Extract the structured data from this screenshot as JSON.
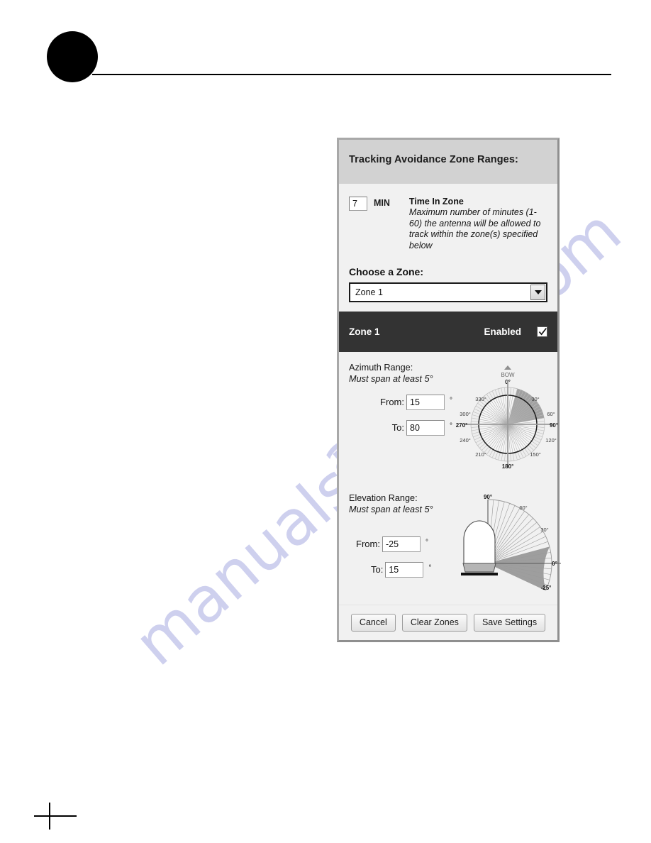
{
  "page": {
    "bullet_icon": "black-circle-bullet",
    "rule": "horizontal-rule",
    "crop_mark": "crop-mark",
    "watermark_text_1": "manualshive",
    "watermark_text_2": "alshive.com"
  },
  "dialog": {
    "title": "Tracking Avoidance Zone Ranges:",
    "time_in_zone": {
      "value": "7",
      "unit_label": "MIN",
      "heading": "Time In Zone",
      "description": "Maximum number of minutes (1-60) the antenna will be allowed to track within the zone(s) specified below"
    },
    "choose_zone": {
      "label": "Choose a Zone:",
      "selected": "Zone 1",
      "options": [
        "Zone 1"
      ],
      "caret_icon": "chevron-down-icon"
    },
    "zone_header": {
      "name": "Zone 1",
      "enabled_label": "Enabled",
      "enabled_checked": true,
      "check_icon": "check-icon",
      "bg_color": "#333333"
    },
    "azimuth": {
      "title": "Azimuth Range:",
      "subtitle": "Must span at least 5°",
      "from_label": "From:",
      "from_value": "15",
      "to_label": "To:",
      "to_value": "80",
      "degree_symbol": "°",
      "diagram": {
        "name": "azimuth-compass-diagram",
        "bow_label": "BOW",
        "bow_marker_icon": "triangle-up-icon",
        "tick_labels": [
          "0°",
          "30°",
          "60°",
          "90°",
          "120°",
          "150°",
          "180°",
          "210°",
          "240°",
          "270°",
          "300°",
          "330°"
        ],
        "bold_labels": [
          "0°",
          "90°",
          "180°",
          "270°"
        ],
        "shaded_from": 15,
        "shaded_to": 80,
        "shade_color": "#9a9a9a",
        "ray_count": 72
      }
    },
    "elevation": {
      "title": "Elevation Range:",
      "subtitle": "Must span at least 5°",
      "from_label": "From:",
      "from_value": "-25",
      "to_label": "To:",
      "to_value": "15",
      "degree_symbol": "°",
      "diagram": {
        "name": "elevation-fan-diagram",
        "tick_labels": [
          "90°",
          "60°",
          "30°",
          "0°",
          "-25°"
        ],
        "shaded_from": -25,
        "shaded_to": 15,
        "shade_color": "#9a9a9a",
        "antenna_icon": "radome-antenna"
      }
    },
    "buttons": {
      "cancel": "Cancel",
      "clear_zones": "Clear Zones",
      "save_settings": "Save Settings"
    }
  },
  "chart_data": [
    {
      "type": "pie",
      "name": "azimuth-compass",
      "title": "Azimuth Range",
      "unit": "degrees",
      "range_start": 15,
      "range_end": 80,
      "axis_ticks": [
        0,
        30,
        60,
        90,
        120,
        150,
        180,
        210,
        240,
        270,
        300,
        330
      ],
      "annotations": [
        "BOW"
      ],
      "grid": true,
      "legend": "none"
    },
    {
      "type": "pie",
      "name": "elevation-fan",
      "title": "Elevation Range",
      "unit": "degrees",
      "range_start": -25,
      "range_end": 15,
      "axis_ticks": [
        -25,
        0,
        30,
        60,
        90
      ],
      "ylim": [
        -25,
        90
      ],
      "grid": true,
      "legend": "none"
    }
  ]
}
